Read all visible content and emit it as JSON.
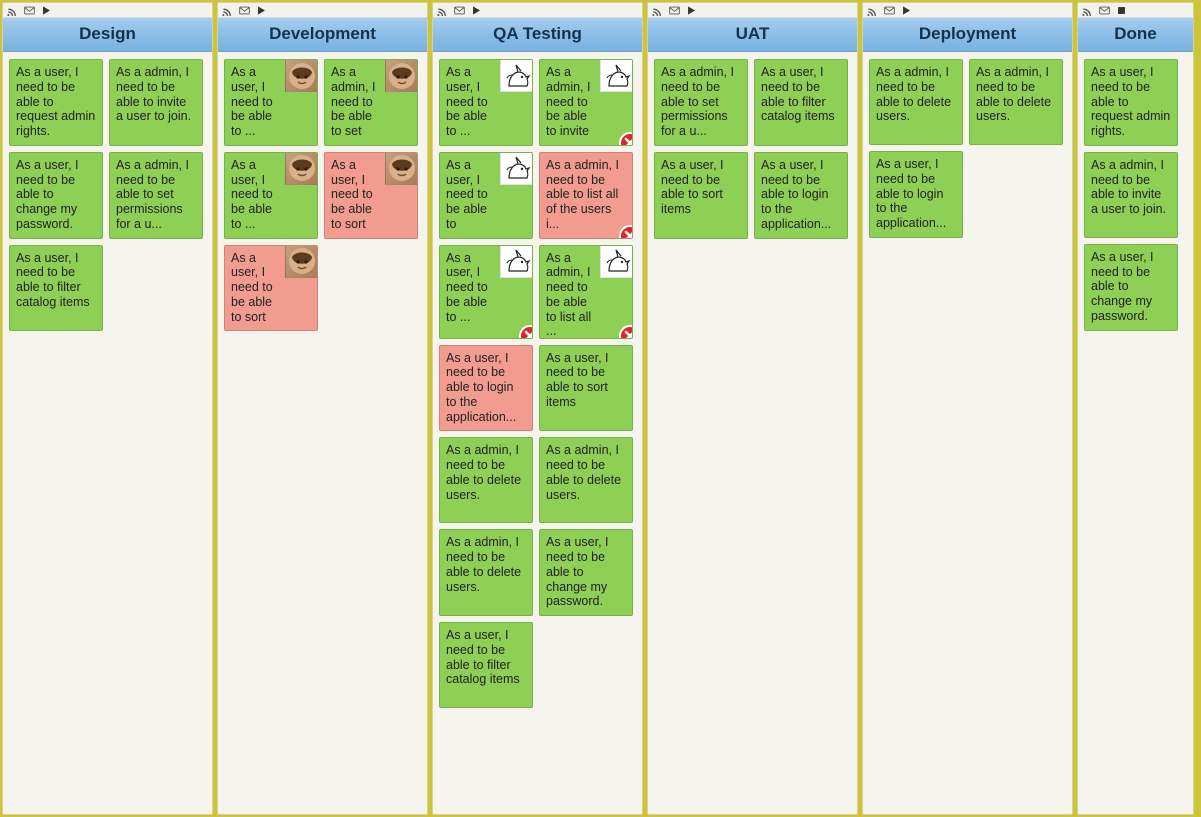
{
  "avatars": {
    "face": "face",
    "unicorn": "unicorn"
  },
  "columns": [
    {
      "id": "design",
      "title": "Design",
      "width": "wide",
      "playing": true,
      "cards": [
        {
          "text": "As a user, I need to be able to request admin rights.",
          "color": "green"
        },
        {
          "text": "As a admin, I need to be able to invite a user to join.",
          "color": "green"
        },
        {
          "text": "As a user, I need to be able to change my password.",
          "color": "green"
        },
        {
          "text": "As a admin, I need to be able to set permissions for a u...",
          "color": "green"
        },
        {
          "text": "As a user, I need to be able to filter catalog items",
          "color": "green"
        }
      ]
    },
    {
      "id": "development",
      "title": "Development",
      "width": "wide",
      "playing": true,
      "cards": [
        {
          "text": "As a user, I need to be able to ...",
          "color": "green",
          "avatar": "face"
        },
        {
          "text": "As a admin, I need to be able to set",
          "color": "green",
          "avatar": "face"
        },
        {
          "text": "As a user, I need to be able to ...",
          "color": "green",
          "avatar": "face"
        },
        {
          "text": "As a user, I need to be able to sort",
          "color": "salmon",
          "avatar": "face"
        },
        {
          "text": "As a user, I need to be able to sort",
          "color": "salmon",
          "avatar": "face"
        }
      ]
    },
    {
      "id": "qa",
      "title": "QA Testing",
      "width": "wide",
      "playing": true,
      "cards": [
        {
          "text": "As a user, I need to be able to ...",
          "color": "green",
          "avatar": "unicorn"
        },
        {
          "text": "As a admin, I need to be able to invite",
          "color": "green",
          "avatar": "unicorn",
          "error": true
        },
        {
          "text": "As a user, I need to be able to",
          "color": "green",
          "avatar": "unicorn"
        },
        {
          "text": "As a admin, I need to be able to list all of the users i...",
          "color": "salmon",
          "error": true
        },
        {
          "text": "As a user, I need to be able to ...",
          "color": "green",
          "avatar": "unicorn",
          "error": true
        },
        {
          "text": "As a admin, I need to be able to list all ...",
          "color": "green",
          "avatar": "unicorn",
          "error": true
        },
        {
          "text": "As a user, I need to be able to login to the application...",
          "color": "salmon"
        },
        {
          "text": "As a user, I need to be able to sort items",
          "color": "green"
        },
        {
          "text": "As a admin, I need to be able to delete users.",
          "color": "green"
        },
        {
          "text": "As a admin, I need to be able to delete users.",
          "color": "green"
        },
        {
          "text": "As a admin, I need to be able to delete users.",
          "color": "green"
        },
        {
          "text": "As a user, I need to be able to change my password.",
          "color": "green"
        },
        {
          "text": "As a user, I need to be able to filter catalog items",
          "color": "green"
        }
      ]
    },
    {
      "id": "uat",
      "title": "UAT",
      "width": "wide",
      "playing": true,
      "cards": [
        {
          "text": "As a admin, I need to be able to set permissions for a u...",
          "color": "green"
        },
        {
          "text": "As a user, I need to be able to filter catalog items",
          "color": "green"
        },
        {
          "text": "As a user, I need to be able to sort items",
          "color": "green"
        },
        {
          "text": "As a user, I need to be able to login to the application...",
          "color": "green"
        }
      ]
    },
    {
      "id": "deployment",
      "title": "Deployment",
      "width": "wide",
      "playing": true,
      "cards": [
        {
          "text": "As a admin, I need to be able to delete users.",
          "color": "green"
        },
        {
          "text": "As a admin, I need to be able to delete users.",
          "color": "green"
        },
        {
          "text": "As a user, I need to be able to login to the application...",
          "color": "green"
        }
      ]
    },
    {
      "id": "done",
      "title": "Done",
      "width": "narrow",
      "playing": false,
      "cards": [
        {
          "text": "As a user, I need to be able to request admin rights.",
          "color": "green"
        },
        {
          "text": "As a admin, I need to be able to invite a user to join.",
          "color": "green"
        },
        {
          "text": "As a user, I need to be able to change my password.",
          "color": "green"
        }
      ]
    }
  ]
}
